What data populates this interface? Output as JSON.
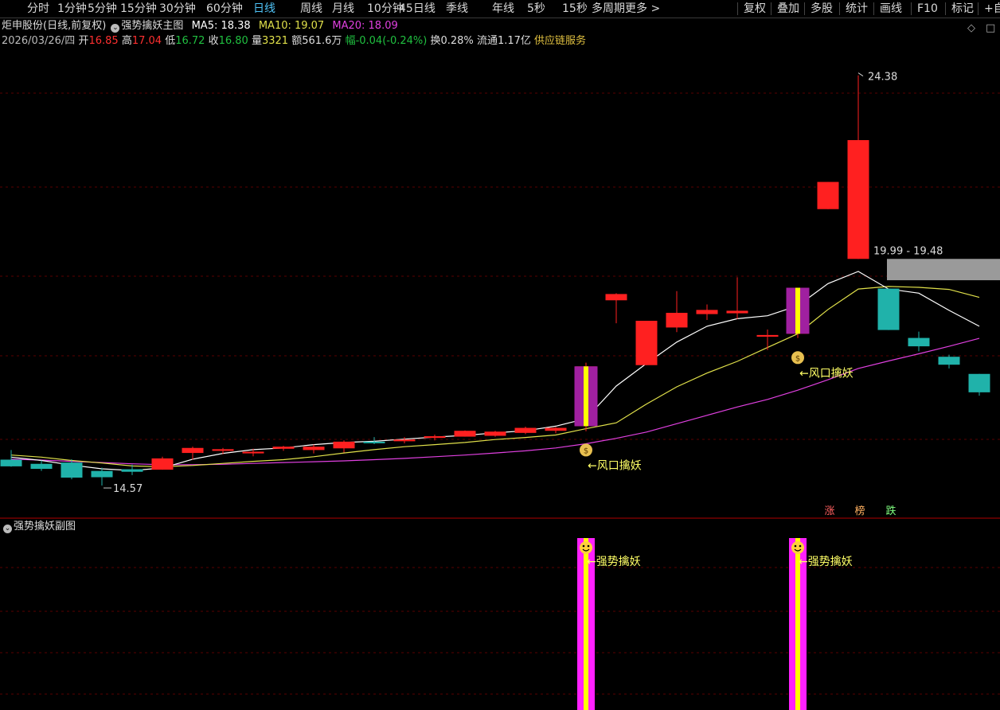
{
  "toolbar": {
    "periods": [
      "分时",
      "1分钟",
      "5分钟",
      "15分钟",
      "30分钟",
      "60分钟",
      "日线",
      "周线",
      "月线",
      "10分钟",
      "45日线",
      "季线",
      "年线",
      "5秒",
      "15秒",
      "多周期",
      "更多 >"
    ],
    "active_period": "日线",
    "right_tools": [
      "复权",
      "叠加",
      "多股",
      "统计",
      "画线",
      "F10",
      "标记",
      "+自"
    ]
  },
  "header": {
    "stock_name": "炬申股份(日线,前复权)",
    "indicator_main": "强势擒妖主图",
    "ma5_label": "MA5: 18.38",
    "ma10_label": "MA10: 19.07",
    "ma20_label": "MA20: 18.09",
    "date": "2026/03/26/四",
    "open_label": "开",
    "open": "16.85",
    "high_label": "高",
    "high": "17.04",
    "low_label": "低",
    "low": "16.72",
    "close_label": "收",
    "close": "16.80",
    "vol_label": "量",
    "vol": "3321",
    "amount": "额561.6万",
    "change": "幅-0.04(-0.24%)",
    "turnover": "换0.28%",
    "float_cap": "流通1.17亿",
    "sector": "供应链服务",
    "corner_icons": [
      "◇",
      "□"
    ]
  },
  "colors": {
    "up": "#ff2020",
    "down": "#20b2aa",
    "ma5": "#ffffff",
    "ma10": "#e0e04a",
    "ma20": "#e040e0",
    "signal_bar": "#a020a0",
    "signal_core": "#ffff00",
    "sub_bar": "#ff20ff",
    "annot": "#ffff66"
  },
  "chart_data": {
    "type": "candlestick",
    "y_range_main": [
      14.0,
      25.0
    ],
    "candles": [
      {
        "o": 15.19,
        "h": 15.42,
        "l": 15.02,
        "c": 15.03
      },
      {
        "o": 15.09,
        "h": 15.17,
        "l": 14.92,
        "c": 14.97
      },
      {
        "o": 15.12,
        "h": 15.2,
        "l": 14.72,
        "c": 14.76
      },
      {
        "o": 14.92,
        "h": 15.0,
        "l": 14.57,
        "c": 14.77
      },
      {
        "o": 14.96,
        "h": 15.07,
        "l": 14.82,
        "c": 14.9
      },
      {
        "o": 14.95,
        "h": 15.26,
        "l": 14.95,
        "c": 15.22
      },
      {
        "o": 15.35,
        "h": 15.5,
        "l": 15.19,
        "c": 15.47
      },
      {
        "o": 15.4,
        "h": 15.47,
        "l": 15.32,
        "c": 15.44
      },
      {
        "o": 15.34,
        "h": 15.45,
        "l": 15.27,
        "c": 15.38
      },
      {
        "o": 15.45,
        "h": 15.52,
        "l": 15.4,
        "c": 15.5
      },
      {
        "o": 15.42,
        "h": 15.55,
        "l": 15.34,
        "c": 15.5
      },
      {
        "o": 15.46,
        "h": 15.65,
        "l": 15.36,
        "c": 15.62
      },
      {
        "o": 15.62,
        "h": 15.73,
        "l": 15.56,
        "c": 15.6
      },
      {
        "o": 15.63,
        "h": 15.73,
        "l": 15.58,
        "c": 15.67
      },
      {
        "o": 15.71,
        "h": 15.79,
        "l": 15.65,
        "c": 15.75
      },
      {
        "o": 15.74,
        "h": 15.89,
        "l": 15.74,
        "c": 15.88
      },
      {
        "o": 15.76,
        "h": 15.88,
        "l": 15.74,
        "c": 15.86
      },
      {
        "o": 15.83,
        "h": 15.98,
        "l": 15.8,
        "c": 15.95
      },
      {
        "o": 15.88,
        "h": 15.97,
        "l": 15.82,
        "c": 15.95
      },
      {
        "o": 15.99,
        "h": 17.51,
        "l": 15.87,
        "c": 17.42
      },
      {
        "o": 19.0,
        "h": 19.17,
        "l": 18.45,
        "c": 19.15
      },
      {
        "o": 17.45,
        "h": 18.51,
        "l": 17.45,
        "c": 18.51
      },
      {
        "o": 18.35,
        "h": 19.22,
        "l": 18.24,
        "c": 18.7
      },
      {
        "o": 18.67,
        "h": 18.9,
        "l": 18.53,
        "c": 18.77
      },
      {
        "o": 18.69,
        "h": 19.55,
        "l": 18.55,
        "c": 18.75
      },
      {
        "o": 18.13,
        "h": 18.3,
        "l": 17.81,
        "c": 18.17
      },
      {
        "o": 18.2,
        "h": 19.3,
        "l": 18.1,
        "c": 19.3
      },
      {
        "o": 21.18,
        "h": 21.83,
        "l": 21.18,
        "c": 21.83
      },
      {
        "o": 19.99,
        "h": 24.38,
        "l": 19.99,
        "c": 22.83
      },
      {
        "o": 19.28,
        "h": 19.28,
        "l": 18.29,
        "c": 18.29
      },
      {
        "o": 18.1,
        "h": 18.25,
        "l": 17.78,
        "c": 17.9
      },
      {
        "o": 17.65,
        "h": 17.7,
        "l": 17.37,
        "c": 17.46
      },
      {
        "o": 17.24,
        "h": 17.24,
        "l": 16.72,
        "c": 16.8
      }
    ],
    "ma5": [
      15.25,
      15.17,
      15.06,
      14.97,
      14.93,
      14.99,
      15.2,
      15.34,
      15.43,
      15.47,
      15.55,
      15.6,
      15.63,
      15.68,
      15.73,
      15.77,
      15.83,
      15.88,
      15.99,
      16.17,
      16.95,
      17.49,
      18.0,
      18.38,
      18.56,
      18.63,
      18.87,
      19.4,
      19.69,
      19.27,
      19.17,
      18.76,
      18.38
    ],
    "ma10": [
      15.3,
      15.25,
      15.17,
      15.11,
      15.04,
      15.02,
      15.05,
      15.1,
      15.15,
      15.19,
      15.26,
      15.35,
      15.43,
      15.5,
      15.55,
      15.6,
      15.67,
      15.72,
      15.78,
      15.93,
      16.07,
      16.52,
      16.93,
      17.26,
      17.54,
      17.87,
      18.2,
      18.78,
      19.27,
      19.33,
      19.31,
      19.26,
      19.07
    ],
    "ma20": [
      15.2,
      15.18,
      15.15,
      15.12,
      15.09,
      15.07,
      15.07,
      15.08,
      15.1,
      15.12,
      15.14,
      15.16,
      15.19,
      15.22,
      15.26,
      15.3,
      15.35,
      15.4,
      15.47,
      15.57,
      15.7,
      15.85,
      16.05,
      16.25,
      16.45,
      16.63,
      16.85,
      17.1,
      17.37,
      17.55,
      17.72,
      17.9,
      18.09
    ],
    "signals": [
      19,
      26
    ],
    "shade": {
      "hi": 19.99,
      "lo": 19.48
    },
    "price_labels": {
      "high": "24.38",
      "low": "14.57",
      "range": "19.99 - 19.48"
    },
    "annotation_main": "←风口擒妖",
    "money_icon": "$",
    "sub_title": "强势擒妖副图",
    "annotation_sub": "←强势擒妖",
    "rank_labels": [
      "涨",
      "榜",
      "跌"
    ]
  }
}
